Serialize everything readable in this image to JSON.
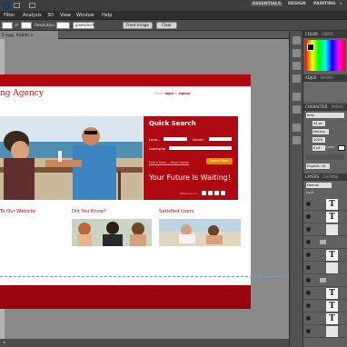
{
  "appbar": {
    "workspaces": [
      "ESSENTIALS",
      "DESIGN",
      "PAINTING"
    ],
    "more_symbol": "»"
  },
  "menubar": {
    "items": [
      "Filter",
      "Analysis",
      "3D",
      "View",
      "Window",
      "Help"
    ]
  },
  "options_bar": {
    "resolution_label": "Resolution:",
    "resolution_unit": "pixels/inch",
    "front_image_label": "Front Image",
    "clear_label": "Clear"
  },
  "document": {
    "tab_label": "5 copy, RGB/8) ×"
  },
  "mockup": {
    "logo_text": "ng Agency",
    "logo_sub": "...",
    "topnav_text": "Please",
    "topnav_login": "login",
    "topnav_or": "or",
    "topnav_signup": "signup",
    "quick_search_title": "Quick Search",
    "search_labels": [
      "Locat...",
      "Gender",
      "Looking for"
    ],
    "search_link": "Find a Date ... More Option",
    "search_button": "Search Now!",
    "tagline": "Your Future Is Waiting!",
    "social_label": "Follow us on:",
    "col1_heading": "To Our Website",
    "col2_heading": "Did You Know?",
    "col3_heading": "Satisfied Users"
  },
  "panels": {
    "color_tab": "COLOR",
    "swatches_tab": "SWATC",
    "adjust_tab": "ADJUS",
    "masks_tab": "MASKS",
    "character_tab": "CHARACTER",
    "paragraph_tab": "PARAG",
    "font_family": "Arial",
    "font_size": "14 pt",
    "leading": "Metrics",
    "tracking_label": "VA",
    "scale": "100%",
    "baseline": "0 pt",
    "color_label": "Color:",
    "language": "English: UK",
    "layers_tab": "LAYERS",
    "channels_tab": "CHANNE",
    "blend_mode": "Normal",
    "lock_label": "Lock:"
  },
  "layers": [
    {
      "type": "text",
      "name": "Te"
    },
    {
      "type": "text",
      "name": "T"
    },
    {
      "type": "image",
      "name": ""
    },
    {
      "type": "text",
      "name": "T"
    },
    {
      "type": "text",
      "name": "T"
    },
    {
      "type": "image",
      "name": ""
    },
    {
      "type": "text",
      "name": "T"
    },
    {
      "type": "text",
      "name": "T"
    },
    {
      "type": "image",
      "name": ""
    },
    {
      "type": "text",
      "name": "T"
    },
    {
      "type": "text",
      "name": "T"
    },
    {
      "type": "text",
      "name": "T"
    },
    {
      "type": "image",
      "name": ""
    }
  ],
  "colors": {
    "brand_red": "#b3070f",
    "search_red": "#ae0911",
    "orange_button": "#e78a0c"
  }
}
